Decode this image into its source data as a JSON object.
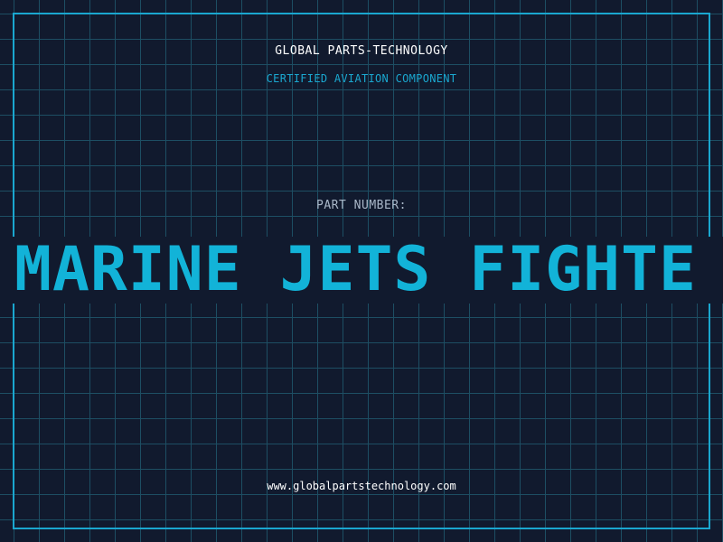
{
  "header": {
    "company": "GLOBAL PARTS-TECHNOLOGY",
    "subtitle": "CERTIFIED AVIATION COMPONENT"
  },
  "part": {
    "label": "PART NUMBER:",
    "value": "MARINE JETS FIGHTE"
  },
  "footer": {
    "website": "www.globalpartstechnology.com"
  },
  "colors": {
    "background": "#111a2e",
    "grid": "#1d4e63",
    "accent": "#1aa7cf",
    "part_number": "#12b3d8"
  }
}
